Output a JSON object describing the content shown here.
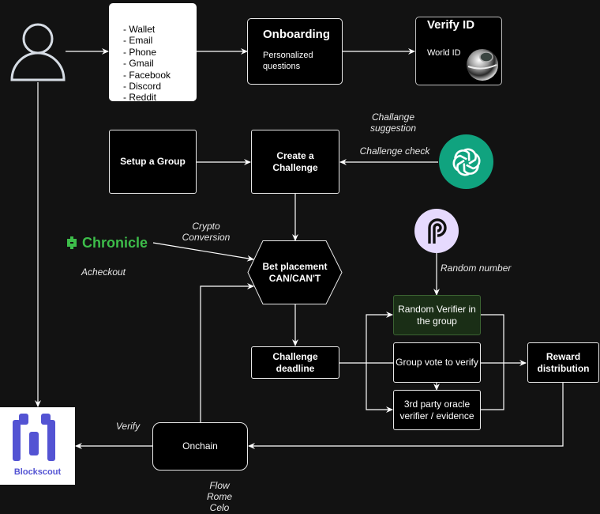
{
  "user": {
    "icon": "user-icon"
  },
  "login_methods": {
    "items": [
      "- Wallet",
      "- Email",
      "- Phone",
      "- Gmail",
      "- Facebook",
      "- Discord",
      "- Reddit"
    ]
  },
  "onboarding": {
    "title": "Onboarding",
    "subtitle_lines": [
      "Personalized",
      "questions"
    ]
  },
  "verify_id": {
    "title": "Verify ID",
    "provider": "World ID",
    "icon": "world-id-orb-icon"
  },
  "setup_group": {
    "label": "Setup a Group"
  },
  "create_challenge": {
    "label_lines": [
      "Create a",
      "Challenge"
    ]
  },
  "openai": {
    "icon": "openai-icon",
    "color": "#10a37f"
  },
  "labels": {
    "challenge_suggestion": [
      "Challange",
      "suggestion"
    ],
    "challenge_check": "Challenge check",
    "crypto_conversion": [
      "Crypto",
      "Conversion"
    ],
    "acheckout": "Acheckout",
    "random_number": "Random number",
    "verify": "Verify",
    "chains": [
      "Flow",
      "Rome",
      "Celo"
    ]
  },
  "chronicle": {
    "name": "Chronicle",
    "color": "#3dbd4a",
    "icon": "chronicle-logo-icon"
  },
  "bet_placement": {
    "label_lines": [
      "Bet placement",
      "CAN/CAN'T"
    ]
  },
  "pyth": {
    "icon": "pyth-logo-icon",
    "color": "#e6dafe"
  },
  "random_verifier": {
    "label_lines": [
      "Random Verifier in",
      "the group"
    ],
    "fill": "#1a2e16",
    "stroke": "#3b6332"
  },
  "group_vote": {
    "label": "Group vote to verify"
  },
  "oracle_verifier": {
    "label_lines": [
      "3rd party oracle",
      "verifier / evidence"
    ]
  },
  "reward": {
    "label_lines": [
      "Reward",
      "distribution"
    ]
  },
  "challenge_deadline": {
    "label_lines": [
      "Challenge",
      "deadline"
    ]
  },
  "onchain": {
    "label": "Onchain"
  },
  "blockscout": {
    "name": "Blockscout",
    "color": "#5353d3",
    "icon": "blockscout-logo-icon"
  }
}
